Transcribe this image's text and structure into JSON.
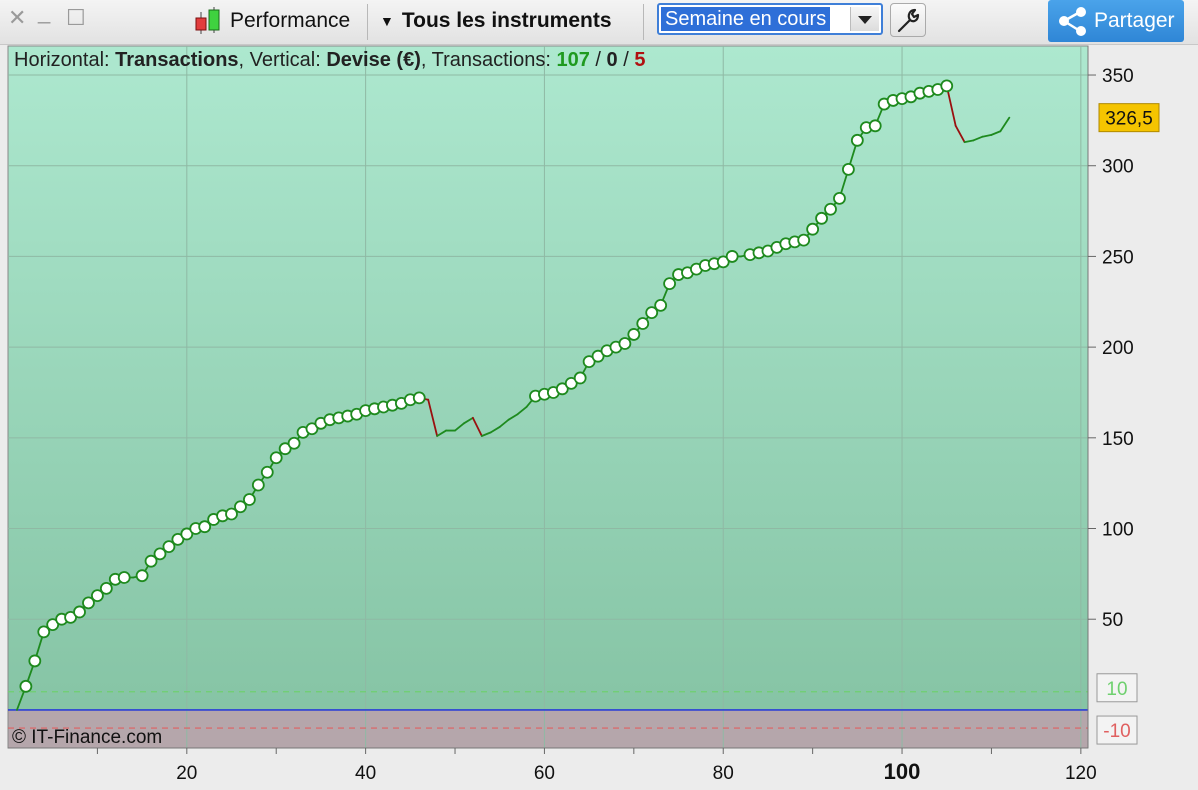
{
  "toolbar": {
    "close_glyph": "✕",
    "minimize_glyph": "_",
    "maximize_glyph": "☐",
    "performance_label": "Performance",
    "instruments_label": "Tous les instruments",
    "period_select_value": "Semaine en cours",
    "share_label": "Partager"
  },
  "header": {
    "horizontal_prefix": "Horizontal: ",
    "horizontal_value": "Transactions",
    "vertical_prefix": ", Vertical: ",
    "vertical_value": "Devise (€)",
    "transactions_prefix": ", Transactions: ",
    "wins": "107",
    "slash1": " / ",
    "neutral": "0",
    "slash2": " / ",
    "losses": "5"
  },
  "copyright": "© IT-Finance.com",
  "colors": {
    "profit_line": "#1e8a1e",
    "loss_line": "#9a1010",
    "zero_line": "#2b3fd6",
    "upper_band": "#6fd06f",
    "lower_band": "#e06060",
    "last_value_badge": "#f5c400",
    "header_wins": "#1f9a1f",
    "header_losses": "#b01010",
    "gain_bg_top": "#ade8cf",
    "gain_bg_bottom": "#86c4a5",
    "loss_bg": "#b5a6ab"
  },
  "chart_data": {
    "type": "line",
    "xlabel": "Transactions",
    "ylabel": "Devise (€)",
    "xlim": [
      0,
      120.8
    ],
    "ylim": [
      -21,
      366
    ],
    "x_ticks": [
      "20",
      "40",
      "60",
      "80",
      "100",
      "120"
    ],
    "x_tick_values": [
      20,
      40,
      60,
      80,
      100,
      120
    ],
    "x_tick_bold": [
      "100"
    ],
    "y_ticks": [
      "50",
      "100",
      "150",
      "200",
      "250",
      "300",
      "350"
    ],
    "y_tick_values": [
      50,
      100,
      150,
      200,
      250,
      300,
      350
    ],
    "thresholds": [
      {
        "label": "10",
        "value": 10
      },
      {
        "label": "-10",
        "value": -10
      }
    ],
    "zero_level": 0,
    "last_value_label": "326,5",
    "last_value": 326.5,
    "grid": true,
    "series": [
      {
        "y": [
          0,
          13,
          27,
          43,
          47,
          50,
          51,
          54,
          59,
          63,
          67,
          72,
          73,
          73,
          74,
          82,
          86,
          90,
          94,
          97,
          100,
          101,
          105,
          107,
          108,
          112,
          116,
          124,
          131,
          139,
          144,
          147,
          153,
          155,
          158,
          160,
          161,
          162,
          163,
          165,
          166,
          167,
          168,
          169,
          171,
          172,
          171,
          151,
          154,
          154,
          158,
          161,
          151,
          153,
          156,
          160,
          163,
          167,
          173,
          174,
          175,
          177,
          180,
          183,
          192,
          195,
          198,
          200,
          202,
          207,
          213,
          219,
          223,
          235,
          240,
          241,
          243,
          245,
          246,
          247,
          250,
          250,
          251,
          252,
          253,
          255,
          257,
          258,
          259,
          265,
          271,
          276,
          282,
          298,
          314,
          321,
          322,
          334,
          336,
          337,
          338,
          340,
          341,
          342,
          344,
          322,
          313,
          314,
          316,
          317,
          319,
          326.5
        ]
      }
    ]
  }
}
